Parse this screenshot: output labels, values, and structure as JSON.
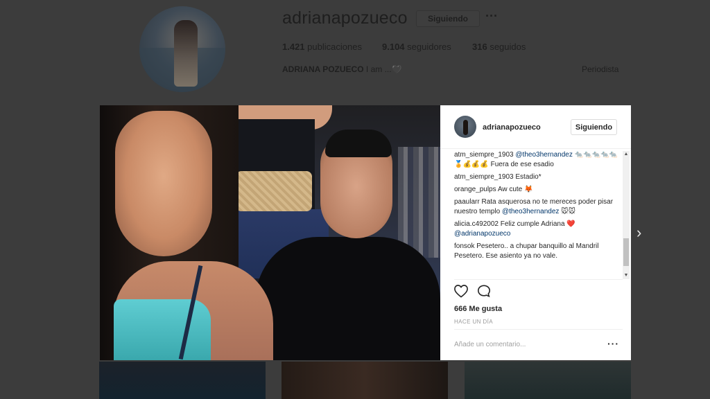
{
  "profile": {
    "username": "adrianapozueco",
    "follow_label": "Siguiendo",
    "more_label": "···",
    "posts_count": "1.421",
    "posts_label": "publicaciones",
    "followers_count": "9.104",
    "followers_label": "seguidores",
    "following_count": "316",
    "following_label": "seguidos",
    "full_name": "ADRIANA POZUECO",
    "bio": "I am ...🖤",
    "category": "Periodista"
  },
  "post": {
    "username": "adrianapozueco",
    "follow_label": "Siguiendo",
    "comments": [
      {
        "user": "atm_siempre_1903",
        "text": "",
        "mention": "@theo3hernandez",
        "suffix": " 🐀🐀🐀🐀🐀🏅💰💰💰 Fuera de ese esadio"
      },
      {
        "user": "atm_siempre_1903",
        "text": "Estadio*",
        "mention": "",
        "suffix": ""
      },
      {
        "user": "orange_pulps",
        "text": "Aw cute 🦊",
        "mention": "",
        "suffix": ""
      },
      {
        "user": "paaularr",
        "text": "Rata asquerosa no te mereces poder pisar nuestro templo",
        "mention": "@theo3hernandez",
        "suffix": " 🐭🐭"
      },
      {
        "user": "alicia.c492002",
        "text": "Feliz cumple Adriana ❤️",
        "mention": "@adrianapozueco",
        "suffix": ""
      },
      {
        "user": "fonsok",
        "text": "Pesetero.. a chupar banquillo al Mandril Pesetero. Ese asiento ya no vale.",
        "mention": "",
        "suffix": ""
      }
    ],
    "likes": "666 Me gusta",
    "time": "HACE UN DÍA",
    "add_comment_placeholder": "Añade un comentario...",
    "more_label": "···"
  },
  "nav": {
    "next_label": "›"
  },
  "colors": {
    "overlay": "#3c3c3c",
    "mention": "#003569",
    "like_heart": "#ed4956"
  }
}
